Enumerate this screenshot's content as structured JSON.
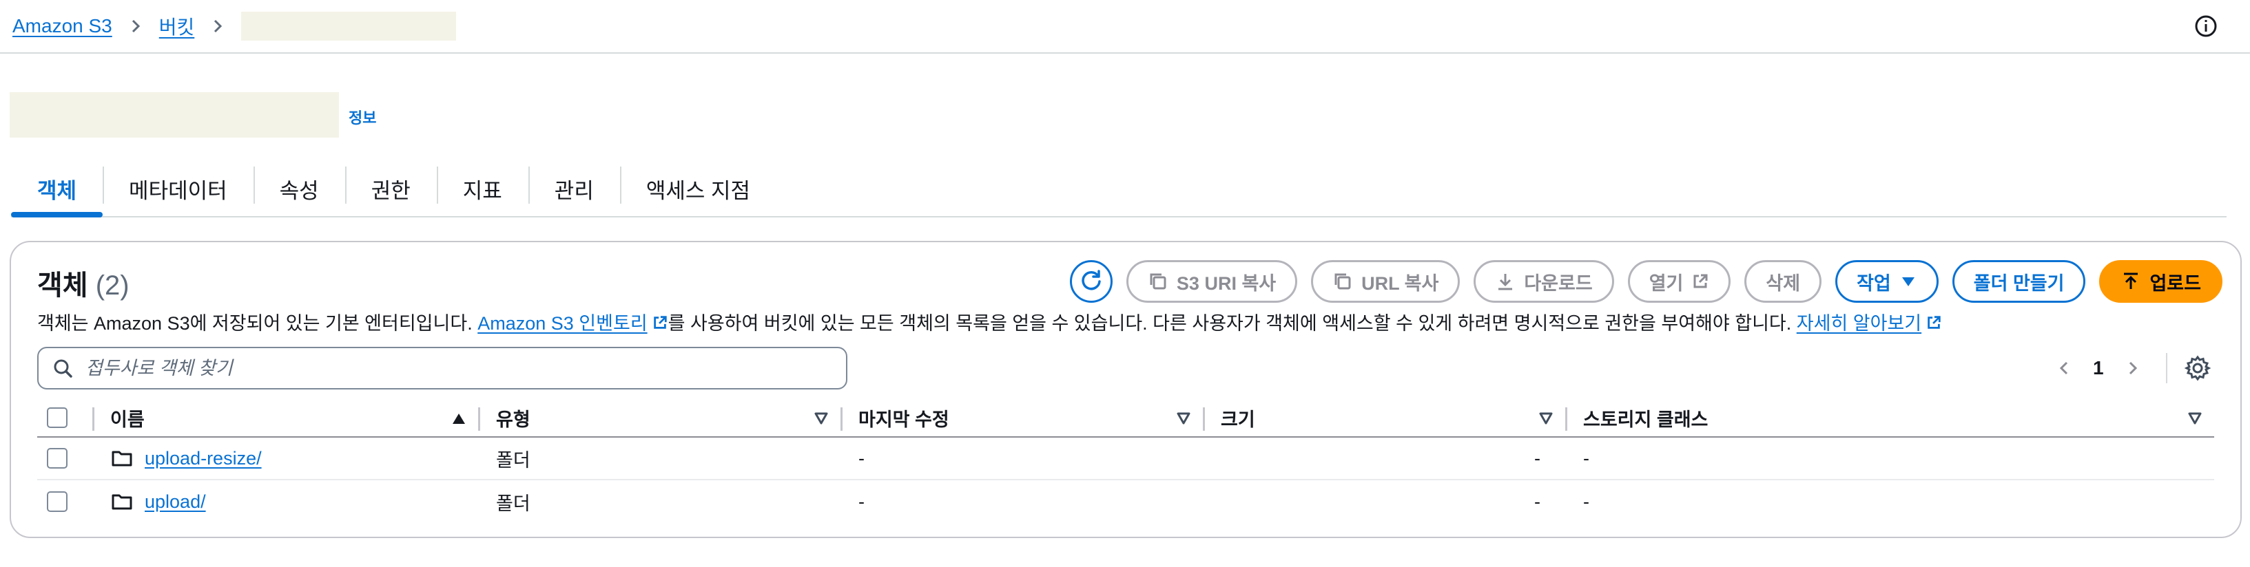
{
  "breadcrumb": {
    "root": "Amazon S3",
    "buckets": "버킷"
  },
  "header": {
    "info_link": "정보"
  },
  "tabs": [
    {
      "label": "객체",
      "active": true
    },
    {
      "label": "메타데이터"
    },
    {
      "label": "속성"
    },
    {
      "label": "권한"
    },
    {
      "label": "지표"
    },
    {
      "label": "관리"
    },
    {
      "label": "액세스 지점"
    }
  ],
  "objects": {
    "title": "객체",
    "count": "(2)",
    "description_pre": "객체는 Amazon S3에 저장되어 있는 기본 엔터티입니다. ",
    "inventory_link": "Amazon S3 인벤토리",
    "description_mid": "를 사용하여 버킷에 있는 모든 객체의 목록을 얻을 수 있습니다. 다른 사용자가 객체에 액세스할 수 있게 하려면 명시적으로 권한을 부여해야 합니다. ",
    "learn_more_link": "자세히 알아보기",
    "actions": {
      "copy_s3_uri": "S3 URI 복사",
      "copy_url": "URL 복사",
      "download": "다운로드",
      "open": "열기",
      "delete": "삭제",
      "actions": "작업",
      "create_folder": "폴더 만들기",
      "upload": "업로드"
    },
    "search": {
      "placeholder": "접두사로 객체 찾기"
    },
    "pagination": {
      "current_page": "1"
    },
    "columns": {
      "name": "이름",
      "type": "유형",
      "last_modified": "마지막 수정",
      "size": "크기",
      "storage_class": "스토리지 클래스"
    },
    "rows": [
      {
        "name": "upload-resize/",
        "type": "폴더",
        "last_modified": "-",
        "size": "-",
        "storage_class": "-"
      },
      {
        "name": "upload/",
        "type": "폴더",
        "last_modified": "-",
        "size": "-",
        "storage_class": "-"
      }
    ]
  },
  "colors": {
    "link": "#0972d3",
    "primary": "#ff9900",
    "border": "#c6c6cd"
  }
}
